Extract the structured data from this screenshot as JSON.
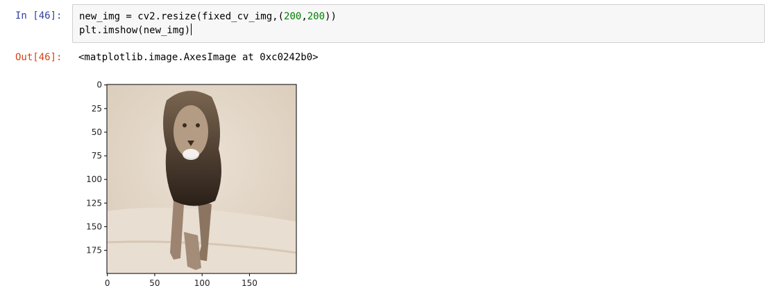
{
  "cell": {
    "in_prompt": "In [46]:",
    "code_line1_a": "new_img = cv2.resize(fixed_cv_img,(",
    "code_line1_n1": "200",
    "code_line1_b": ",",
    "code_line1_n2": "200",
    "code_line1_c": "))",
    "code_line2": "plt.imshow(new_img)",
    "out_prompt": "Out[46]:",
    "output_text": "<matplotlib.image.AxesImage at 0xc0242b0>"
  },
  "plot": {
    "image_description_icon": "lion-photo-image",
    "y_ticks": [
      "0",
      "25",
      "50",
      "75",
      "100",
      "125",
      "150",
      "175"
    ],
    "x_ticks": [
      "0",
      "50",
      "100",
      "150"
    ],
    "colors": {
      "axis": "#000000",
      "image_tone": "#c9b9a4"
    }
  }
}
